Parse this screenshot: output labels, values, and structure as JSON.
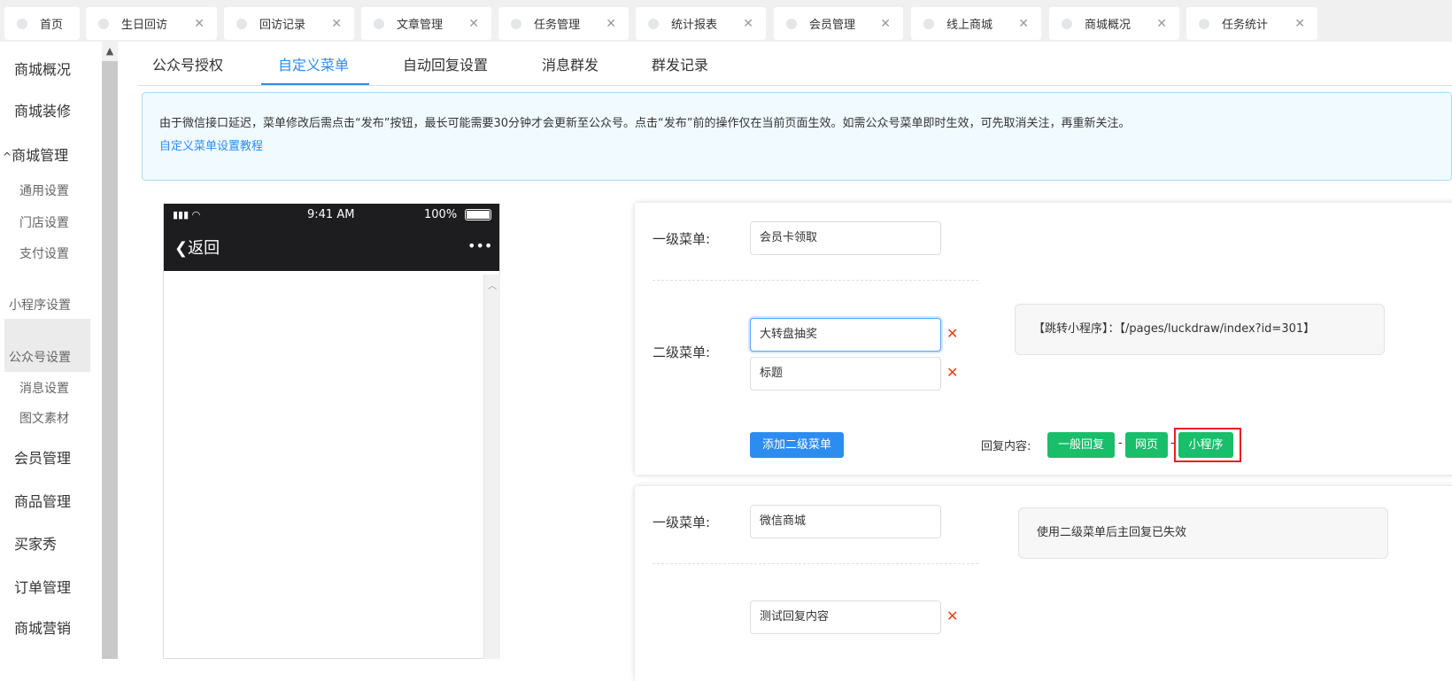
{
  "tabs": [
    {
      "label": "首页"
    },
    {
      "label": "生日回访"
    },
    {
      "label": "回访记录"
    },
    {
      "label": "文章管理"
    },
    {
      "label": "任务管理"
    },
    {
      "label": "统计报表"
    },
    {
      "label": "会员管理"
    },
    {
      "label": "线上商城"
    },
    {
      "label": "商城概况"
    },
    {
      "label": "任务统计"
    }
  ],
  "sidebar": {
    "items": [
      "商城概况",
      "商城装修",
      "商城管理",
      "通用设置",
      "门店设置",
      "支付设置",
      "小程序设置",
      "公众号设置",
      "消息设置",
      "图文素材",
      "会员管理",
      "商品管理",
      "买家秀",
      "订单管理",
      "商城营销"
    ],
    "collapse_icon": "^"
  },
  "subtabs": [
    "公众号授权",
    "自定义菜单",
    "自动回复设置",
    "消息群发",
    "群发记录"
  ],
  "notice": {
    "text": "由于微信接口延迟，菜单修改后需点击“发布”按钮，最长可能需要30分钟才会更新至公众号。点击“发布”前的操作仅在当前页面生效。如需公众号菜单即时生效，可先取消关注，再重新关注。",
    "link": "自定义菜单设置教程"
  },
  "phone": {
    "time": "9:41 AM",
    "battery": "100%",
    "back": "返回",
    "more": "•••"
  },
  "menu1": {
    "level1_label": "一级菜单:",
    "level1_value": "会员卡领取",
    "level2_label": "二级菜单:",
    "sub": [
      "大转盘抽奖",
      "标题"
    ],
    "tip": "【跳转小程序】：【/pages/luckdraw/index?id=301】",
    "add_button": "添加二级菜单",
    "reply_label": "回复内容:",
    "reply_options": [
      "一般回复",
      "网页",
      "小程序"
    ],
    "sep": "-"
  },
  "menu2": {
    "level1_label": "一级菜单:",
    "level1_value": "微信商城",
    "tip": "使用二级菜单后主回复已失效",
    "sub": [
      "测试回复内容"
    ]
  },
  "colors": {
    "primary": "#2d8cf0",
    "green": "#19be6b",
    "highlight": "#ed1c24"
  }
}
